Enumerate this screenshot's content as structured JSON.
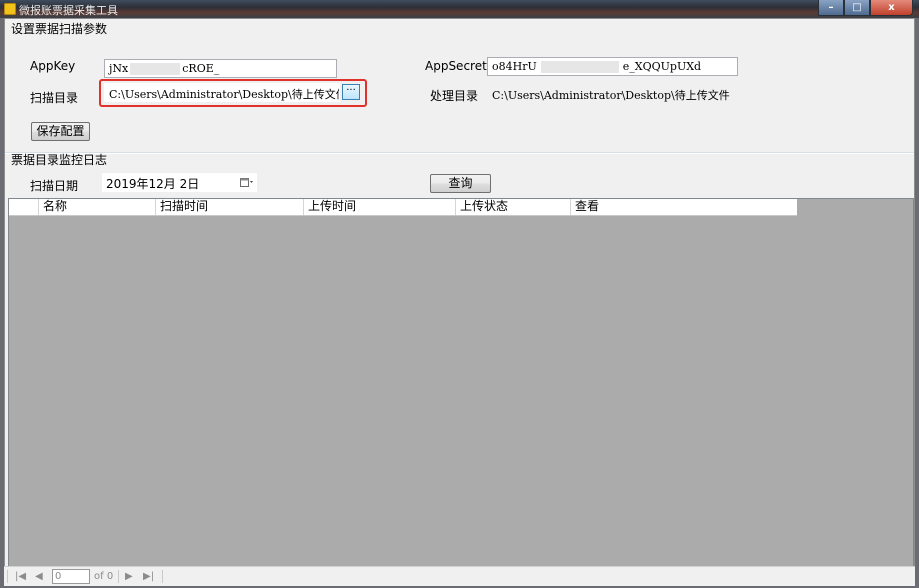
{
  "window": {
    "title": "微报账票据采集工具",
    "controls": {
      "minimize": "–",
      "maximize": "□",
      "close": "x"
    }
  },
  "settings": {
    "section_title": "设置票据扫描参数",
    "appkey_label": "AppKey",
    "appkey_prefix": "jNx",
    "appkey_suffix": "cROE_",
    "appsecret_label": "AppSecret",
    "appsecret_prefix": "o84HrU",
    "appsecret_suffix": "e_XQQUpUXd",
    "scan_dir_label": "扫描目录",
    "scan_dir_value": "C:\\Users\\Administrator\\Desktop\\待上传文件",
    "browse_label": "···",
    "process_dir_label": "处理目录",
    "process_dir_value": "C:\\Users\\Administrator\\Desktop\\待上传文件",
    "save_button": "保存配置"
  },
  "log": {
    "section_title": "票据目录监控日志",
    "scan_date_label": "扫描日期",
    "scan_date_value": "2019年12月 2日",
    "query_button": "查询",
    "columns": [
      "名称",
      "扫描时间",
      "上传时间",
      "上传状态",
      "查看"
    ]
  },
  "navigator": {
    "first": "|◀",
    "prev": "◀",
    "page_value": "0",
    "page_of": "of 0",
    "next": "▶",
    "last": "▶|"
  },
  "colors": {
    "highlight": "#e0312a",
    "grid_background": "#ababab"
  }
}
